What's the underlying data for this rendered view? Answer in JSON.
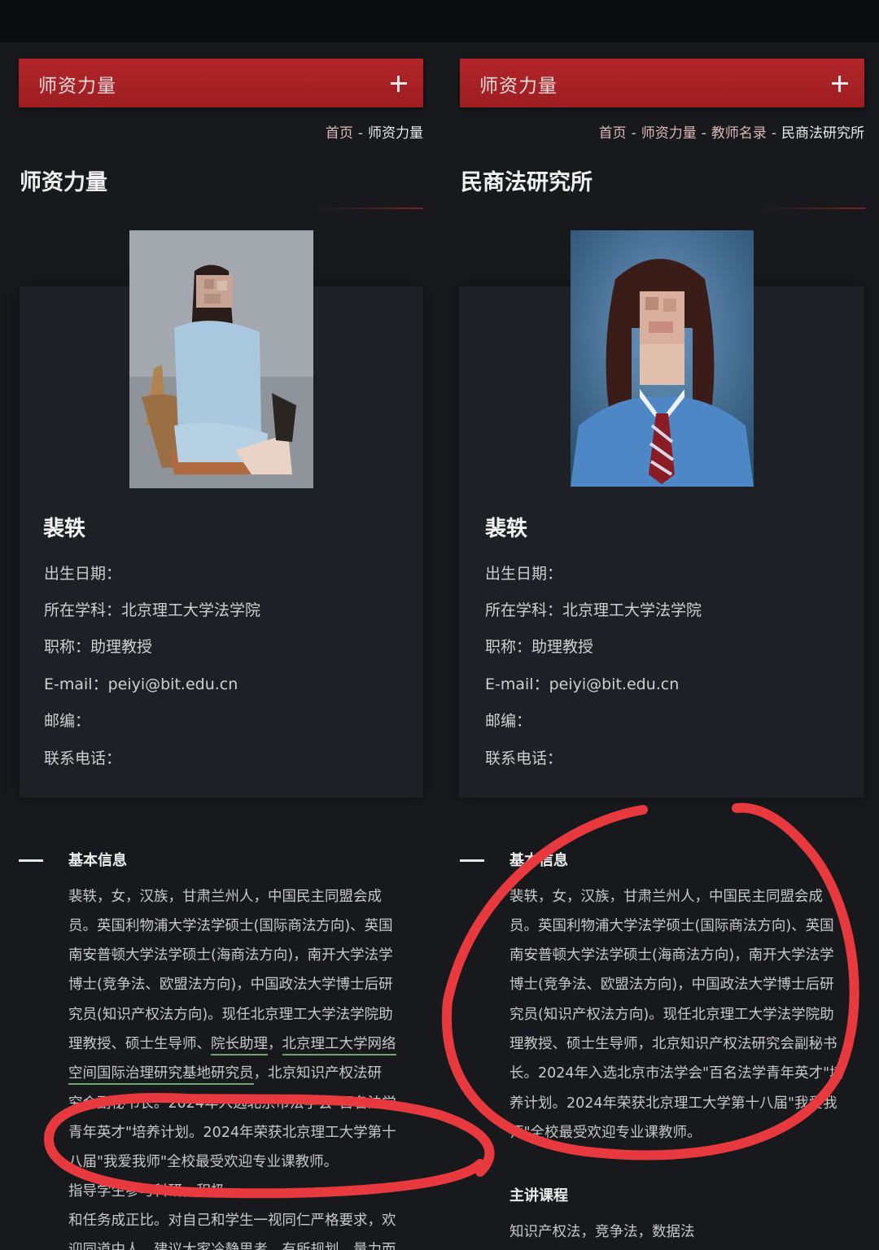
{
  "left": {
    "header": {
      "title": "师资力量"
    },
    "breadcrumb": {
      "home": "首页",
      "sep": "-",
      "current": "师资力量"
    },
    "page_title": "师资力量",
    "profile": {
      "name": "裴轶",
      "fields": [
        "出生日期：",
        "所在学科：北京理工大学法学院",
        "职称：助理教授",
        "E-mail：peiyi@bit.edu.cn",
        "邮编：",
        "联系电话："
      ]
    },
    "section": {
      "title": "基本信息",
      "lines": [
        "裴轶，女，汉族，甘肃兰州人，中国民主同盟会成",
        "员。英国利物浦大学法学硕士(国际商法方向)、英国",
        "南安普顿大学法学硕士(海商法方向)，南开大学法学",
        "博士(竞争法、欧盟法方向)，中国政法大学博士后研",
        "究员(知识产权法方向)。现任北京理工大学法学院助",
        "理教授、硕士生导师、",
        "院长助理",
        "，",
        "北京理工大学网络",
        "空间国际治理研究基地研究员",
        "，北京知识产权法研",
        "究会副秘书长。2024年入选北京市法学会\"百名法学",
        "青年英才\"培养计划。2024年荣获北京理工大学第十",
        "八届\"我爱我师\"全校最受欢迎专业课教师。",
        "指导学生参与科研，积极",
        "和任务成正比。对自己和学生一视同仁严格要求，欢",
        "迎同道中人，建议大家冷静思考，有所规划，量力而"
      ]
    }
  },
  "right": {
    "header": {
      "title": "师资力量"
    },
    "breadcrumb": {
      "items": [
        "首页",
        "师资力量",
        "教师名录"
      ],
      "current": "民商法研究所",
      "sep": "-"
    },
    "page_title": "民商法研究所",
    "profile": {
      "name": "裴轶",
      "fields": [
        "出生日期：",
        "所在学科：北京理工大学法学院",
        "职称：助理教授",
        "E-mail：peiyi@bit.edu.cn",
        "邮编：",
        "联系电话："
      ]
    },
    "section": {
      "title": "基本信息",
      "lines": [
        "裴轶，女，汉族，甘肃兰州人，中国民主同盟会成",
        "员。英国利物浦大学法学硕士(国际商法方向)、英国",
        "南安普顿大学法学硕士(海商法方向)，南开大学法学",
        "博士(竞争法、欧盟法方向)，中国政法大学博士后研",
        "究员(知识产权法方向)。现任北京理工大学法学院助",
        "理教授、硕士生导师，北京知识产权法研究会副秘书",
        "长。2024年入选北京市法学会\"百名法学青年英才\"培",
        "养计划。2024年荣获北京理工大学第十八届\"我爱我",
        "师\"全校最受欢迎专业课教师。"
      ]
    },
    "courses": {
      "title": "主讲课程",
      "text": "知识产权法，竞争法，数据法"
    }
  },
  "colors": {
    "accent": "#b3262a",
    "annotation": "#e8393f",
    "highlight": "#6da86b",
    "background": "#17191c"
  }
}
